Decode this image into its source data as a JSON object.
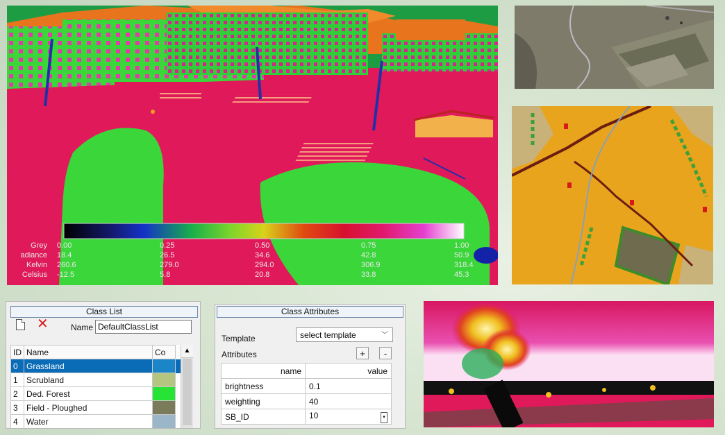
{
  "colorbar": {
    "rows": [
      {
        "label": "Grey",
        "values": [
          "0.00",
          "0.25",
          "0.50",
          "0.75",
          "1.00"
        ]
      },
      {
        "label": "adiance",
        "values": [
          "18.4",
          "26.5",
          "34.6",
          "42.8",
          "50.9"
        ]
      },
      {
        "label": "Kelvin",
        "values": [
          "260.6",
          "279.0",
          "294.0",
          "306.9",
          "318.4"
        ]
      },
      {
        "label": "Celsius",
        "values": [
          "-12.5",
          "5.8",
          "20.8",
          "33.8",
          "45.3"
        ]
      }
    ]
  },
  "class_list": {
    "title": "Class List",
    "name_label": "Name",
    "name_value": "DefaultClassList",
    "columns": {
      "id": "ID",
      "name": "Name",
      "color": "Co"
    },
    "rows": [
      {
        "id": "0",
        "name": "Grassland",
        "color": "#1a86c8",
        "selected": true
      },
      {
        "id": "1",
        "name": "Scrubland",
        "color": "#b3c57e"
      },
      {
        "id": "2",
        "name": "Ded. Forest",
        "color": "#27e335"
      },
      {
        "id": "3",
        "name": "Field - Ploughed",
        "color": "#7b7a5b"
      },
      {
        "id": "4",
        "name": "Water",
        "color": "#9bb6c8"
      }
    ]
  },
  "class_attributes": {
    "title": "Class Attributes",
    "template_label": "Template",
    "template_value": "select template",
    "attributes_label": "Attributes",
    "plus": "+",
    "minus": "-",
    "columns": {
      "name": "name",
      "value": "value"
    },
    "rows": [
      {
        "name": "brightness",
        "value": "0.1"
      },
      {
        "name": "weighting",
        "value": "40"
      },
      {
        "name": "SB_ID",
        "value": "10"
      }
    ]
  },
  "icons": [
    "new-document-icon",
    "delete-x-icon",
    "chevron-down-icon",
    "scroll-up-icon",
    "spinner-icon"
  ]
}
